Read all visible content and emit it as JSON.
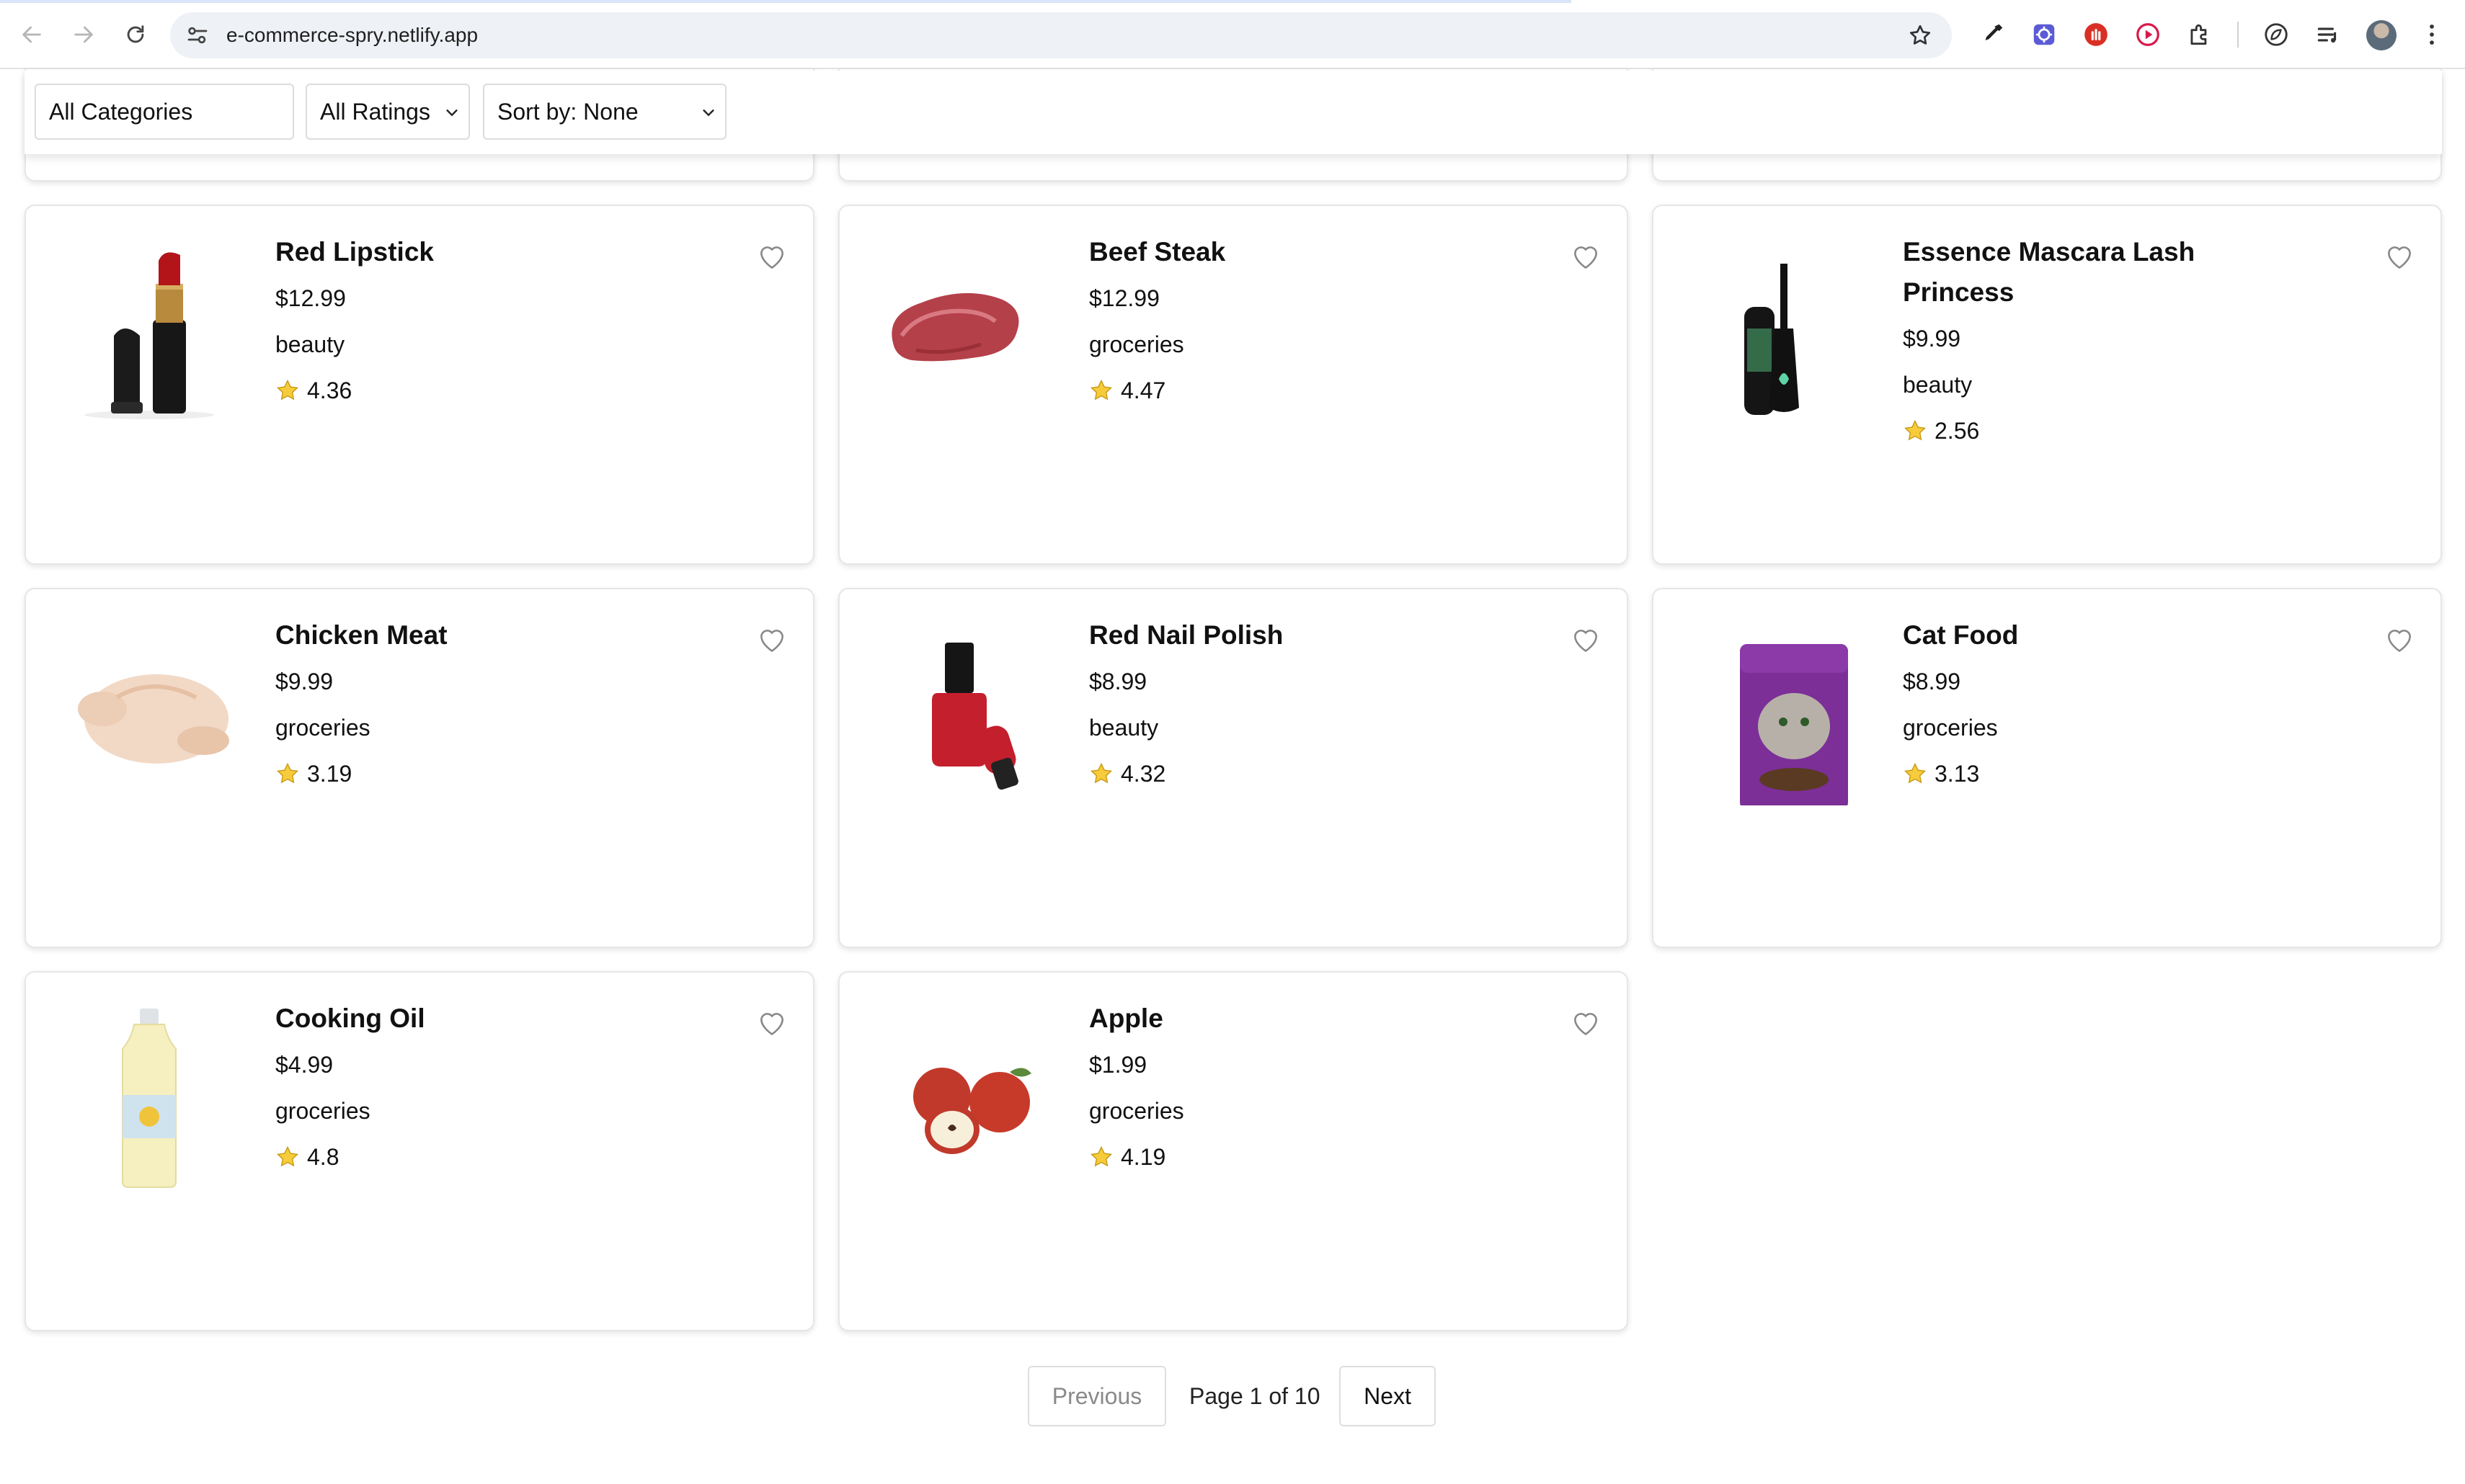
{
  "browser": {
    "url": "e-commerce-spry.netlify.app"
  },
  "filters": {
    "category": "All Categories",
    "rating": "All Ratings",
    "sort": "Sort by: None"
  },
  "products": [
    {
      "name": "Red Lipstick",
      "price": "$12.99",
      "category": "beauty",
      "rating": "4.36"
    },
    {
      "name": "Beef Steak",
      "price": "$12.99",
      "category": "groceries",
      "rating": "4.47"
    },
    {
      "name": "Essence Mascara Lash Princess",
      "price": "$9.99",
      "category": "beauty",
      "rating": "2.56"
    },
    {
      "name": "Chicken Meat",
      "price": "$9.99",
      "category": "groceries",
      "rating": "3.19"
    },
    {
      "name": "Red Nail Polish",
      "price": "$8.99",
      "category": "beauty",
      "rating": "4.32"
    },
    {
      "name": "Cat Food",
      "price": "$8.99",
      "category": "groceries",
      "rating": "3.13"
    },
    {
      "name": "Cooking Oil",
      "price": "$4.99",
      "category": "groceries",
      "rating": "4.8"
    },
    {
      "name": "Apple",
      "price": "$1.99",
      "category": "groceries",
      "rating": "4.19"
    }
  ],
  "pagination": {
    "previous": "Previous",
    "info": "Page 1 of 10",
    "next": "Next"
  }
}
